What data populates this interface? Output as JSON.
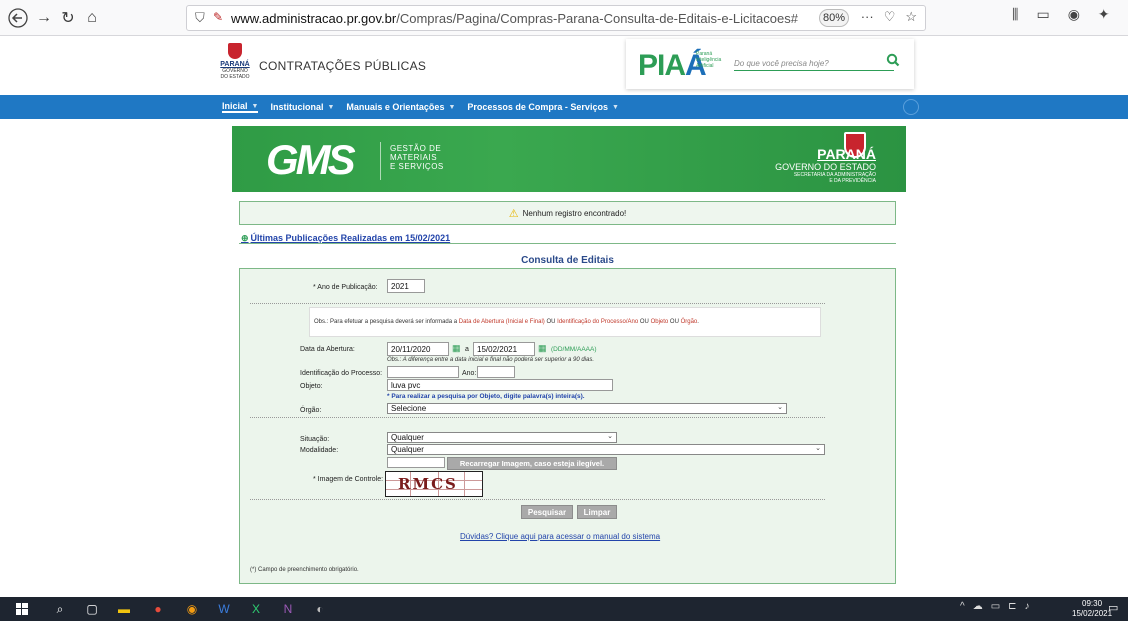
{
  "browser": {
    "url_host": "www.administracao.pr.gov.br",
    "url_path": "/Compras/Pagina/Compras-Parana-Consulta-de-Editais-e-Licitacoes#",
    "zoom": "80%",
    "more": "···"
  },
  "header": {
    "logo_name": "PARANÁ",
    "logo_sub": "GOVERNO DO ESTADO",
    "title": "CONTRATAÇÕES PÚBLICAS",
    "pia_logo": "PIA",
    "pia_accent": "Á",
    "pia_sub": "Paraná Inteligência Artificial",
    "search_placeholder": "Do que você precisa hoje?"
  },
  "nav": {
    "items": [
      {
        "label": "Inicial"
      },
      {
        "label": "Institucional"
      },
      {
        "label": "Manuais e Orientações"
      },
      {
        "label": "Processos de Compra - Serviços"
      }
    ]
  },
  "banner": {
    "logo": "GMS",
    "sub1": "GESTÃO DE",
    "sub2": "MATERIAIS",
    "sub3": "E SERVIÇOS",
    "pr_name": "PARANÁ",
    "pr_gov": "GOVERNO DO ESTADO",
    "pr_sec1": "SECRETARIA DA ADMINISTRAÇÃO",
    "pr_sec2": "E DA PREVIDÊNCIA"
  },
  "message": "Nenhum registro encontrado!",
  "publications_link": "Últimas Publicações Realizadas em 15/02/2021",
  "section_title": "Consulta de Editais",
  "form": {
    "ano_label": "* Ano de Publicação:",
    "ano_value": "2021",
    "obs_prefix": "Obs.: Para efetuar a pesquisa deverá ser informada a",
    "obs_red1": "Data de Abertura (Inicial e Final)",
    "obs_mid1": "OU",
    "obs_red2": "Identificação do Processo/Ano",
    "obs_mid2": "OU",
    "obs_red3": "Objeto",
    "obs_mid3": "OU",
    "obs_red4": "Órgão",
    "data_label": "Data da Abertura:",
    "data_inicial": "20/11/2020",
    "data_sep": "a",
    "data_final": "15/02/2021",
    "data_format": "(DD/MM/AAAA)",
    "data_note": "Obs.: A diferença entre a data inicial e final não poderá ser superior a 90 dias.",
    "ident_label": "Identificação do Processo:",
    "ident_value": "",
    "ano2_label": "Ano:",
    "ano2_value": "",
    "objeto_label": "Objeto:",
    "objeto_value": "luva pvc",
    "objeto_note": "* Para realizar a pesquisa por Objeto, digite palavra(s) inteira(s).",
    "orgao_label": "Órgão:",
    "orgao_value": "Selecione",
    "situacao_label": "Situação:",
    "situacao_value": "Qualquer",
    "modalidade_label": "Modalidade:",
    "modalidade_value": "Qualquer",
    "captcha_input": "",
    "reload_btn": "Recarregar Imagem, caso esteja ilegível.",
    "captcha_label": "* Imagem de Controle:",
    "captcha_code": "RMCS",
    "search_btn": "Pesquisar",
    "clear_btn": "Limpar",
    "manual_link": "Dúvidas? Clique aqui para acessar o manual do sistema",
    "footnote": "(*) Campo de preenchimento obrigatório."
  },
  "taskbar": {
    "time": "09:30",
    "date": "15/02/2021"
  }
}
